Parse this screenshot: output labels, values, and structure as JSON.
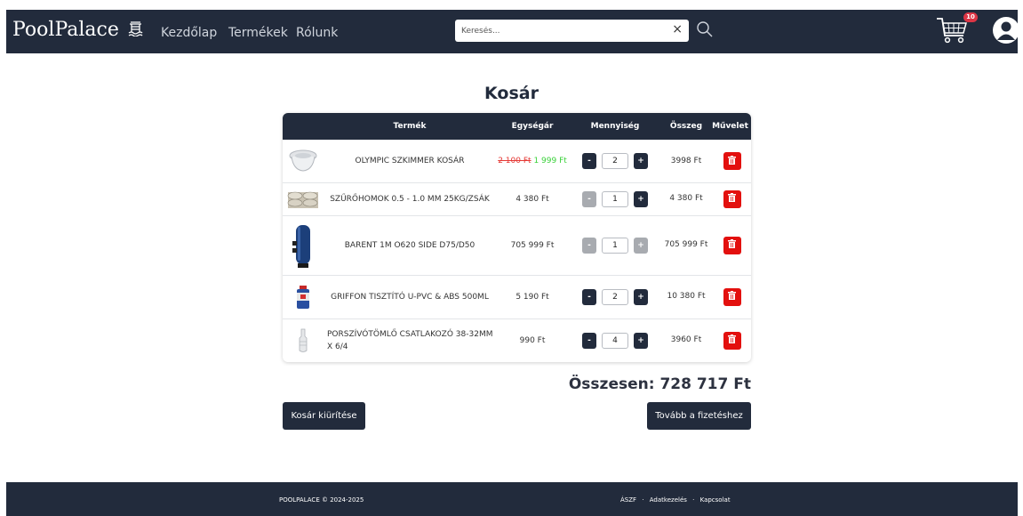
{
  "header": {
    "brand": "PoolPalace",
    "nav": [
      "Kezdőlap",
      "Termékek",
      "Rólunk"
    ],
    "search_placeholder": "Keresés...",
    "search_clear": "×",
    "cart_badge": "10"
  },
  "page": {
    "title": "Kosár"
  },
  "table": {
    "headers": [
      "Termék",
      "Egységár",
      "Mennyiség",
      "Összeg",
      "Művelet"
    ],
    "rows": [
      {
        "name": "OLYMPIC SZKIMMER KOSÁR",
        "old_price": "2 100 Ft",
        "price": "1 999 Ft",
        "quantity": "2",
        "total": "3998 Ft",
        "minus_disabled": false,
        "plus_disabled": false,
        "image": "skimmer-basket"
      },
      {
        "name": "SZŰRŐHOMOK 0.5 - 1.0 MM 25KG/ZSÁK",
        "price": "4 380 Ft",
        "quantity": "1",
        "total": "4 380 Ft",
        "minus_disabled": true,
        "plus_disabled": false,
        "image": "sand-bags"
      },
      {
        "name": "BARENT 1M O620 SIDE D75/D50",
        "price": "705 999 Ft",
        "quantity": "1",
        "total": "705 999 Ft",
        "minus_disabled": true,
        "plus_disabled": true,
        "image": "filter-tank"
      },
      {
        "name": "GRIFFON TISZTÍTÓ U-PVC & ABS 500ML",
        "price": "5 190 Ft",
        "quantity": "2",
        "total": "10 380 Ft",
        "minus_disabled": false,
        "plus_disabled": false,
        "image": "cleaner-can"
      },
      {
        "name": "PORSZÍVÓTÖMLŐ CSATLAKOZÓ 38-32MM X 6/4",
        "price": "990 Ft",
        "quantity": "4",
        "total": "3960 Ft",
        "minus_disabled": false,
        "plus_disabled": false,
        "image": "hose-connector"
      }
    ],
    "minus_label": "-",
    "plus_label": "+"
  },
  "summary": {
    "total": "Összesen: 728 717 Ft"
  },
  "buttons": {
    "empty_cart": "Kosár kiürítése",
    "checkout": "Tovább a fizetéshez"
  },
  "footer": {
    "copyright": "POOLPALACE © 2024-2025",
    "links": [
      "ÁSZF",
      "Adatkezelés",
      "Kapcsolat"
    ],
    "separator": "·"
  },
  "colors": {
    "navy": "#222b3c",
    "delete_red": "#e3100e",
    "old_price": "#e53935",
    "discount_price": "#3ad13a",
    "badge": "#dc3545",
    "disabled": "#a8abb0"
  }
}
